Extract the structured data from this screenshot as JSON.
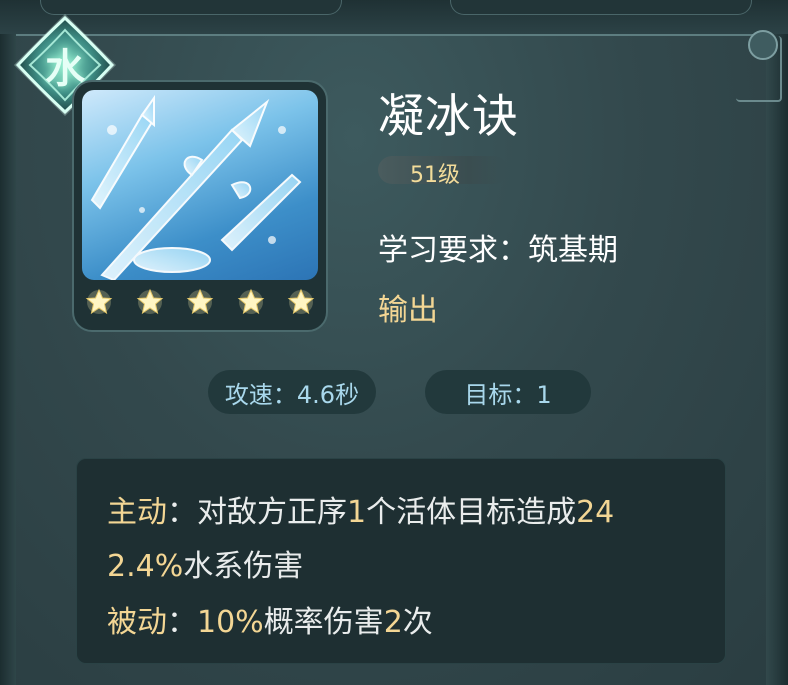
{
  "skill": {
    "element": "水",
    "name": "凝冰诀",
    "level": "51级",
    "requirement": "学习要求：筑基期",
    "role": "输出",
    "stars": 5,
    "icon": "ice-trident-art-icon"
  },
  "stats": {
    "attack_speed": "攻速：4.6秒",
    "targets": "目标：1"
  },
  "description": {
    "active_label": "主动",
    "active_text_1a": "：对敌方正序",
    "active_num_1": "1",
    "active_text_1b": "个活体目标造成",
    "active_num_2": "24",
    "active_num_3": "2.4%",
    "active_text_2": "水系伤害",
    "passive_label": "被动",
    "passive_sep": "：",
    "passive_num_1": "10%",
    "passive_text_1": "概率伤害",
    "passive_num_2": "2",
    "passive_text_2": "次"
  },
  "colors": {
    "highlight": "#f3d694",
    "stat_text": "#a9d8ec",
    "panel": "#33494d"
  }
}
